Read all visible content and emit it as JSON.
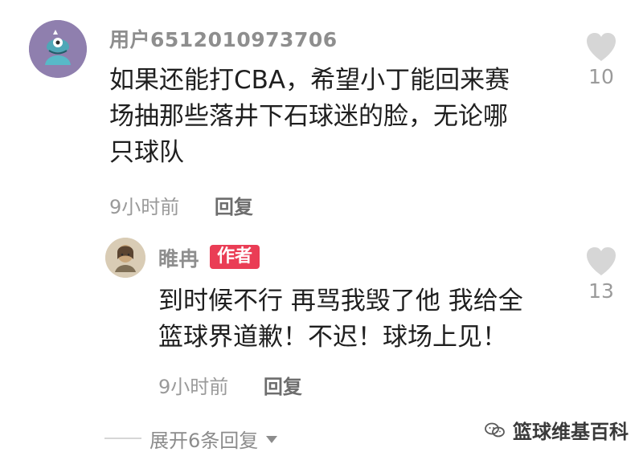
{
  "main_comment": {
    "username": "用户6512010973706",
    "content_lines": [
      "如果还能打CBA，希望小丁能回来赛",
      "场抽那些落井下石球迷的脸，无论哪",
      "只球队"
    ],
    "time": "9小时前",
    "reply_label": "回复",
    "like_count": "10",
    "like_icon": "heart-icon"
  },
  "reply_comment": {
    "username": "睢冉",
    "author_badge": "作者",
    "content_lines": [
      "到时候不行 再骂我毁了他 我给全",
      "篮球界道歉！不迟！球场上见！"
    ],
    "time": "9小时前",
    "reply_label": "回复",
    "like_count": "13",
    "like_icon": "heart-icon"
  },
  "expand_replies": {
    "label": "展开6条回复",
    "icon": "triangle-down-icon"
  },
  "watermark": {
    "text": "篮球维基百科",
    "icon": "wechat-icon"
  },
  "colors": {
    "username": "#8e8e8e",
    "meta": "#9a9a9a",
    "heart": "#d6d6d6",
    "author_badge": "#ea3d55",
    "expand_text": "#8c8c8c"
  }
}
